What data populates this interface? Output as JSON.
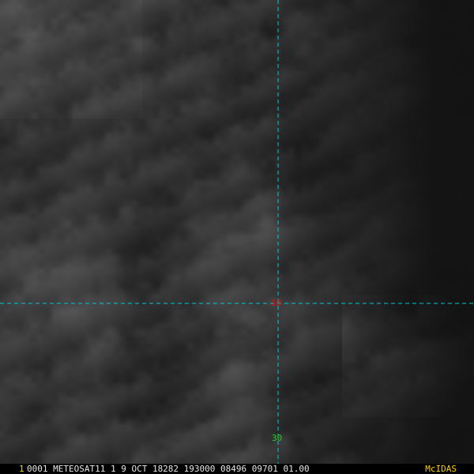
{
  "imagery": {
    "description_icon": "satellite-visible-imagery"
  },
  "overlay": {
    "grid_color": "#00c8d8",
    "lat_label": "10",
    "lat_label_color": "#d01818",
    "lon_label": "30",
    "lon_label_color": "#20d020"
  },
  "status": {
    "frame_number": "1",
    "frame_color": "#ffd000",
    "text": "0001 METEOSAT11  1  9 OCT 18282 193000 08496 09701 01.00",
    "brand": "McIDAS",
    "brand_color": "#ffd000"
  }
}
